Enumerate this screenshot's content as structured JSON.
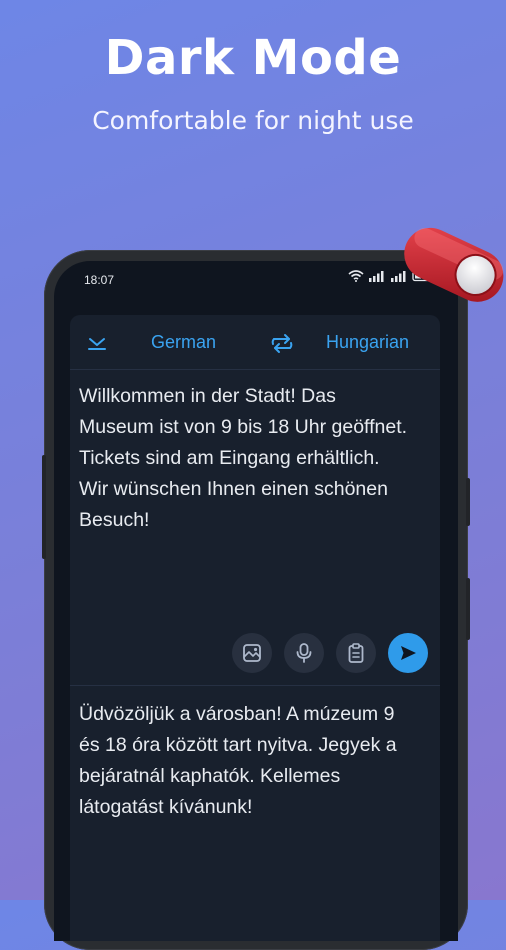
{
  "promo": {
    "title": "Dark Mode",
    "subtitle": "Comfortable for night use"
  },
  "status_bar": {
    "time": "18:07",
    "battery": "39"
  },
  "language_bar": {
    "source_language": "German",
    "target_language": "Hungarian"
  },
  "source": {
    "text": "Willkommen in der Stadt! Das Museum ist von 9 bis 18 Uhr geöffnet. Tickets sind am Eingang erhältlich. Wir wünschen Ihnen einen schönen Besuch!"
  },
  "translation": {
    "text": "Üdvözöljük a városban! A múzeum 9 és 18 óra között tart nyitva. Jegyek a bejáratnál kaphatók. Kellemes látogatást kívánunk!"
  },
  "icons": {
    "collapse": "chevron-down-icon",
    "swap": "swap-icon",
    "image": "image-icon",
    "microphone": "microphone-icon",
    "clipboard": "clipboard-icon",
    "send": "send-icon"
  },
  "colors": {
    "accent": "#3aa3f0",
    "background_gradient_start": "#6e86e6",
    "background_gradient_end": "#8877cf",
    "screen_bg": "#0f151f",
    "card_bg": "#18202d",
    "toggle": "#c8202a"
  }
}
